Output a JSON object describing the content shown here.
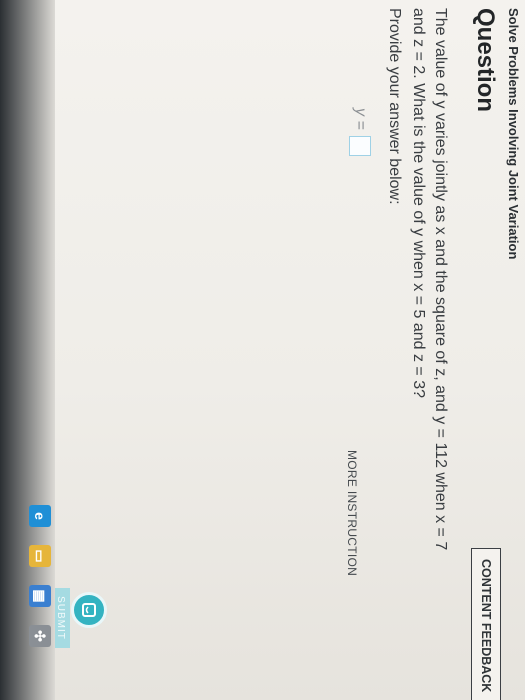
{
  "page": {
    "section_title": "Solve Problems Involving Joint Variation",
    "heading": "Question",
    "content_feedback_label": "CONTENT FEEDBACK",
    "question_line1": "The value of y varies jointly as x and the square of z, and y = 112 when x = 7",
    "question_line2": "and z = 2. What is the value of y when x = 5 and z = 3?",
    "provide_prompt": "Provide your answer below:",
    "answer_label": "y =",
    "answer_value": "",
    "more_instruction": "MORE INSTRUCTION",
    "submit_label": "SUBMIT"
  },
  "colors": {
    "accent": "#34b3c1",
    "answer_border": "#9fd1e6"
  },
  "taskbar_icons": [
    "edge-icon",
    "file-explorer-icon",
    "store-icon",
    "app-grid-icon"
  ]
}
